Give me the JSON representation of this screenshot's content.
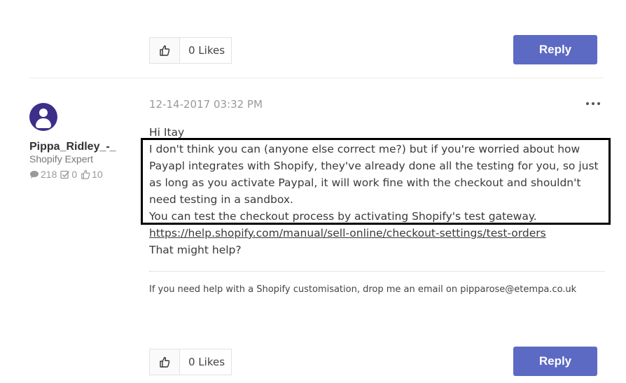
{
  "top_actions": {
    "likes_label": "0 Likes",
    "reply_label": "Reply"
  },
  "author": {
    "username": "Pippa_Ridley_-_",
    "rank": "Shopify Expert",
    "stats": {
      "posts": "218",
      "solutions": "0",
      "likes": "10"
    }
  },
  "post": {
    "timestamp": "12-14-2017 03:32 PM",
    "greeting": "Hi Itay",
    "paragraph1": "I don't think you can (anyone else correct me?) but if you're worried about how Payapl integrates with Shopify, they've already done all the testing for you, so just as long as you activate Paypal, it will work fine with the checkout and shouldn't need testing in a sandbox.",
    "paragraph2": "You can test the checkout process by activating Shopify's test gateway.",
    "link": "https://help.shopify.com/manual/sell-online/checkout-settings/test-orders",
    "closing": "That might help?",
    "signature": "If you need help with a Shopify customisation, drop me an email on pipparose@etempa.co.uk"
  },
  "bottom_actions": {
    "likes_label": "0 Likes",
    "reply_label": "Reply"
  },
  "colors": {
    "reply_button": "#5c6ac4",
    "avatar": "#3d2e8a"
  },
  "icons": [
    "thumbs-up-icon",
    "comment-icon",
    "check-icon",
    "ellipsis-icon",
    "user-icon"
  ]
}
